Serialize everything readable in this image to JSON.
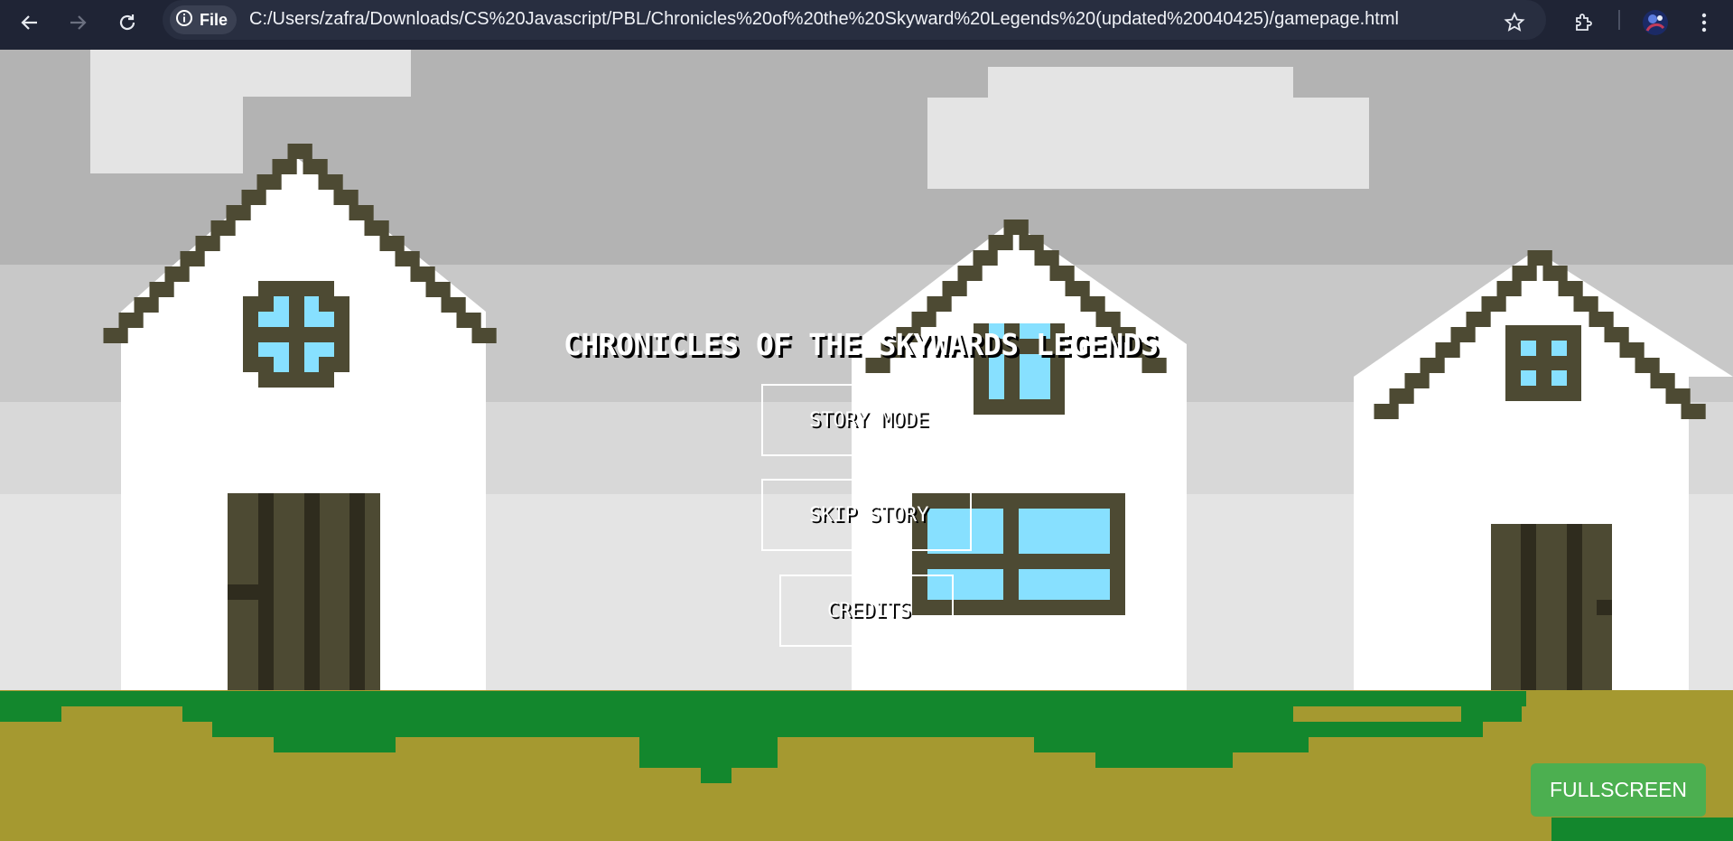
{
  "browser": {
    "file_chip_label": "File",
    "url": "C:/Users/zafra/Downloads/CS%20Javascript/PBL/Chronicles%20of%20the%20Skyward%20Legends%20(updated%20040425)/gamepage.html",
    "icons": [
      "back-arrow-icon",
      "forward-arrow-icon",
      "reload-icon",
      "info-icon",
      "star-icon",
      "extensions-icon",
      "profile-avatar-icon",
      "kebab-menu-icon"
    ]
  },
  "game": {
    "title": "CHRONICLES OF THE SKYWARDS LEGENDS",
    "menu": {
      "story_mode": "STORY MODE",
      "skip_story": "SKIP STORY",
      "credits": "CREDITS"
    },
    "fullscreen_label": "FULLSCREEN"
  },
  "colors": {
    "sky_top": "#b3b3b3",
    "sky_mid": "#c8c8c8",
    "sky_low": "#d8d8d8",
    "sky_bottom": "#e4e4e4",
    "cloud": "#e4e4e4",
    "wall": "#ffffff",
    "roof_outline": "#4d4a33",
    "window_glass": "#87e0ff",
    "door_dark": "#2f2c1e",
    "grass": "#13872d",
    "dirt": "#a59930",
    "button_green": "#4caf50",
    "browser_bar": "#1f2435"
  }
}
